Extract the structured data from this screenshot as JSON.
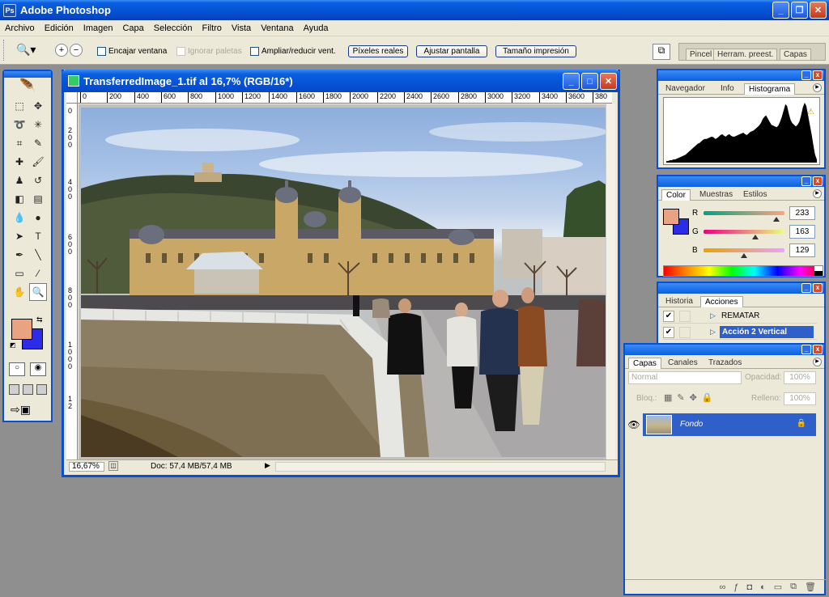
{
  "app": {
    "title": "Adobe Photoshop"
  },
  "menu": [
    "Archivo",
    "Edición",
    "Imagen",
    "Capa",
    "Selección",
    "Filtro",
    "Vista",
    "Ventana",
    "Ayuda"
  ],
  "options": {
    "fit_window": "Encajar ventana",
    "ignore_palettes": "Ignorar paletas",
    "zoom_resize": "Ampliar/reducir vent.",
    "actual_pixels": "Píxeles reales",
    "fit_screen": "Ajustar pantalla",
    "print_size": "Tamaño impresión",
    "well_tabs": [
      "Pincel",
      "Herram. preest.",
      "Capas"
    ]
  },
  "document": {
    "title": "TransferredImage_1.tif al 16,7% (RGB/16*)",
    "ruler_h": [
      "0",
      "200",
      "400",
      "600",
      "800",
      "1000",
      "1200",
      "1400",
      "1600",
      "1800",
      "2000",
      "2200",
      "2400",
      "2600",
      "2800",
      "3000",
      "3200",
      "3400",
      "3600",
      "380"
    ],
    "ruler_v": [
      "0",
      "2",
      "0",
      "0",
      "4",
      "0",
      "0",
      "6",
      "0",
      "0",
      "8",
      "0",
      "0",
      "1",
      "0",
      "0",
      "0",
      "1",
      "2"
    ],
    "zoom": "16,67%",
    "doc_info": "Doc: 57,4 MB/57,4 MB"
  },
  "navigator": {
    "tabs": [
      "Navegador",
      "Info",
      "Histograma"
    ],
    "histogram": [
      2,
      2,
      3,
      3,
      4,
      4,
      5,
      6,
      7,
      8,
      9,
      10,
      12,
      14,
      16,
      18,
      20,
      22,
      24,
      25,
      27,
      29,
      30,
      30,
      31,
      32,
      33,
      32,
      30,
      31,
      33,
      35,
      36,
      34,
      33,
      35,
      36,
      34,
      33,
      33,
      34,
      35,
      36,
      37,
      38,
      36,
      35,
      37,
      39,
      40,
      41,
      43,
      45,
      47,
      50,
      55,
      58,
      60,
      56,
      52,
      48,
      47,
      46,
      45,
      47,
      52,
      58,
      66,
      74,
      72,
      62,
      54,
      50,
      48,
      46,
      48,
      52,
      60,
      70,
      76,
      72,
      60,
      48,
      36,
      22,
      10,
      4
    ]
  },
  "color": {
    "tabs": [
      "Color",
      "Muestras",
      "Estilos"
    ],
    "r_label": "R",
    "g_label": "G",
    "b_label": "B",
    "r": "233",
    "g": "163",
    "b": "129",
    "fg": "#e9a381",
    "bg": "#2b2be8"
  },
  "actions": {
    "tabs": [
      "Historia",
      "Acciones"
    ],
    "items": [
      {
        "label": "REMATAR",
        "selected": false
      },
      {
        "label": "Acción 2 Vertical",
        "selected": true
      }
    ]
  },
  "layers": {
    "tabs": [
      "Capas",
      "Canales",
      "Trazados"
    ],
    "blend_mode": "Normal",
    "opacity_label": "Opacidad:",
    "opacity": "100%",
    "lock_label": "Bloq.:",
    "fill_label": "Relleno:",
    "fill": "100%",
    "items": [
      {
        "name": "Fondo"
      }
    ]
  }
}
